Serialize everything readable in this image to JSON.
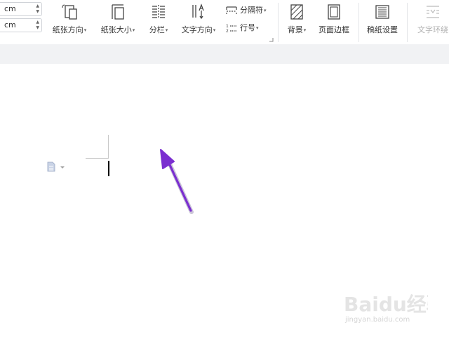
{
  "margins": {
    "field1_value": "cm",
    "field2_value": "cm"
  },
  "ribbon": {
    "orientation_label": "纸张方向",
    "paper_size_label": "纸张大小",
    "columns_label": "分栏",
    "text_direction_label": "文字方向",
    "breaks_label": "分隔符",
    "line_numbers_label": "行号",
    "background_label": "背景",
    "page_border_label": "页面边框",
    "manuscript_label": "稿纸设置",
    "wrap_text_label": "文字环绕"
  },
  "icons": {
    "orientation": "page-orientation-icon",
    "paper_size": "paper-size-icon",
    "columns": "columns-icon",
    "text_direction": "text-direction-icon",
    "breaks": "breaks-icon",
    "line_numbers": "line-numbers-icon",
    "background": "background-icon",
    "page_border": "page-border-icon",
    "manuscript": "manuscript-grid-icon",
    "wrap_text": "text-wrap-icon"
  },
  "colors": {
    "annotation_arrow": "#7b2fd0",
    "ribbon_band": "#f1f2f4"
  },
  "watermark": {
    "brand": "Baidu经验",
    "url": "jingyan.baidu.com"
  }
}
